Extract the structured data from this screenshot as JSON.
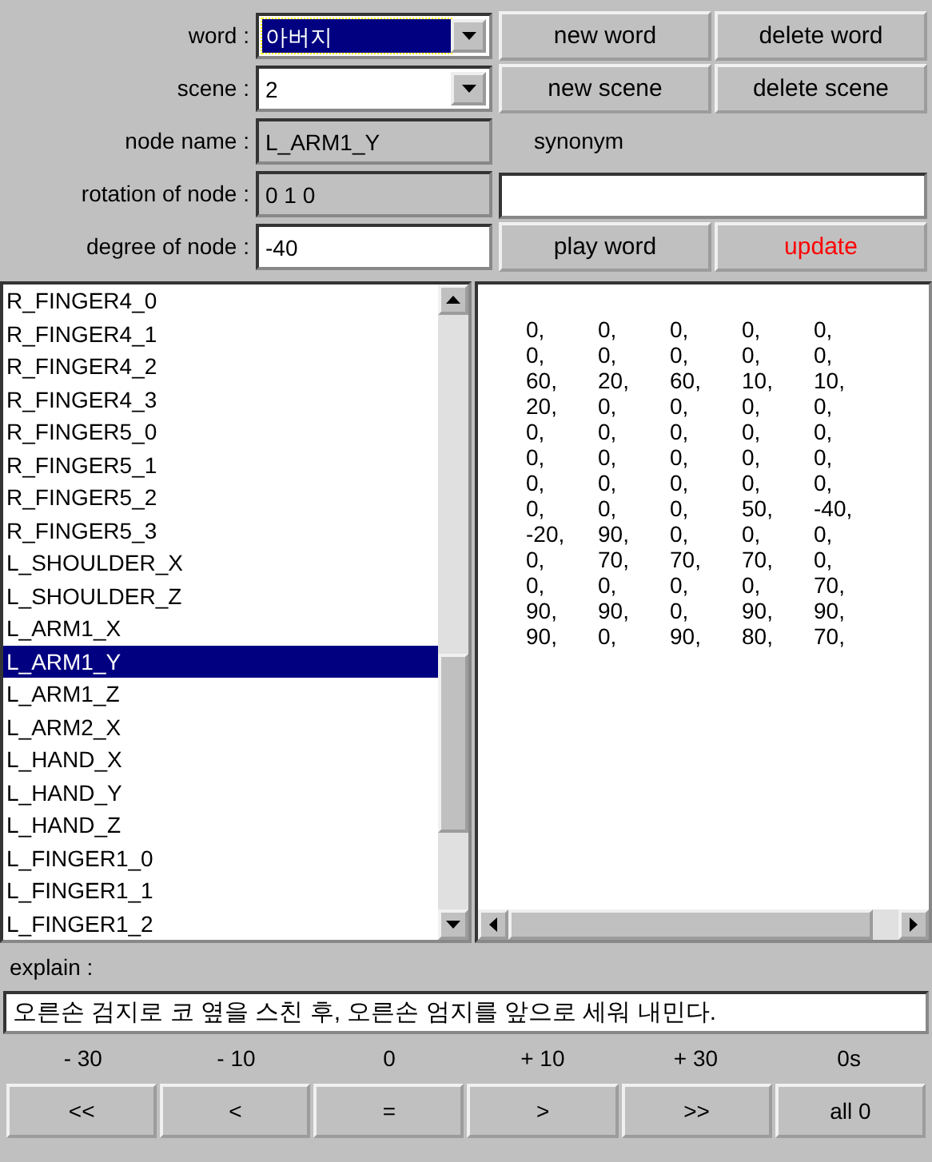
{
  "form_rows": [
    {
      "label": "word :",
      "field": {
        "kind": "combo",
        "value": "아버지",
        "selected": true
      },
      "right": [
        {
          "kind": "button",
          "label": "new word"
        },
        {
          "kind": "button",
          "label": "delete word"
        }
      ]
    },
    {
      "label": "scene :",
      "field": {
        "kind": "combo",
        "value": "2",
        "selected": false
      },
      "right": [
        {
          "kind": "button",
          "label": "new scene"
        },
        {
          "kind": "button",
          "label": "delete scene"
        }
      ]
    },
    {
      "label": "node name :",
      "field": {
        "kind": "readonly",
        "value": "L_ARM1_Y"
      },
      "right": [
        {
          "kind": "label",
          "label": "synonym"
        }
      ]
    },
    {
      "label": "rotation of node :",
      "field": {
        "kind": "readonly",
        "value": "0 1 0"
      },
      "right": [
        {
          "kind": "input"
        }
      ]
    },
    {
      "label": "degree of node :",
      "field": {
        "kind": "input",
        "value": "-40"
      },
      "right": [
        {
          "kind": "button",
          "label": "play word"
        },
        {
          "kind": "button",
          "label": "update",
          "color": "#ff0000"
        }
      ]
    }
  ],
  "nodes": [
    {
      "name": "R_FINGER4_0",
      "selected": false
    },
    {
      "name": "R_FINGER4_1",
      "selected": false
    },
    {
      "name": "R_FINGER4_2",
      "selected": false
    },
    {
      "name": "R_FINGER4_3",
      "selected": false
    },
    {
      "name": "R_FINGER5_0",
      "selected": false
    },
    {
      "name": "R_FINGER5_1",
      "selected": false
    },
    {
      "name": "R_FINGER5_2",
      "selected": false
    },
    {
      "name": "R_FINGER5_3",
      "selected": false
    },
    {
      "name": "L_SHOULDER_X",
      "selected": false
    },
    {
      "name": "L_SHOULDER_Z",
      "selected": false
    },
    {
      "name": "L_ARM1_X",
      "selected": false
    },
    {
      "name": "L_ARM1_Y",
      "selected": true
    },
    {
      "name": "L_ARM1_Z",
      "selected": false
    },
    {
      "name": "L_ARM2_X",
      "selected": false
    },
    {
      "name": "L_HAND_X",
      "selected": false
    },
    {
      "name": "L_HAND_Y",
      "selected": false
    },
    {
      "name": "L_HAND_Z",
      "selected": false
    },
    {
      "name": "L_FINGER1_0",
      "selected": false
    },
    {
      "name": "L_FINGER1_1",
      "selected": false
    },
    {
      "name": "L_FINGER1_2",
      "selected": false
    }
  ],
  "values": [
    [
      "0,",
      "0,",
      "0,",
      "0,",
      "0,"
    ],
    [
      "0,",
      "0,",
      "0,",
      "0,",
      "0,"
    ],
    [
      "60,",
      "20,",
      "60,",
      "10,",
      "10,"
    ],
    [
      "20,",
      "0,",
      "0,",
      "0,",
      "0,"
    ],
    [
      "0,",
      "0,",
      "0,",
      "0,",
      "0,"
    ],
    [
      "0,",
      "0,",
      "0,",
      "0,",
      "0,"
    ],
    [
      "0,",
      "0,",
      "0,",
      "0,",
      "0,"
    ],
    [
      "0,",
      "0,",
      "0,",
      "50,",
      "-40,"
    ],
    [
      "-20,",
      "90,",
      "0,",
      "0,",
      "0,"
    ],
    [
      "0,",
      "70,",
      "70,",
      "70,",
      "0,"
    ],
    [
      "0,",
      "0,",
      "0,",
      "0,",
      "70,"
    ],
    [
      "90,",
      "90,",
      "0,",
      "90,",
      "90,"
    ],
    [
      "90,",
      "0,",
      "90,",
      "80,",
      "70,"
    ]
  ],
  "explain": {
    "label": "explain :",
    "value": "오른손 검지로 코 옆을 스친 후, 오른손 엄지를 앞으로 세워 내민다."
  },
  "offsets": [
    "- 30",
    "- 10",
    "0",
    "+ 10",
    "+ 30",
    "0s"
  ],
  "step_buttons": [
    "<<",
    "<",
    "=",
    ">",
    ">>",
    "all 0"
  ]
}
